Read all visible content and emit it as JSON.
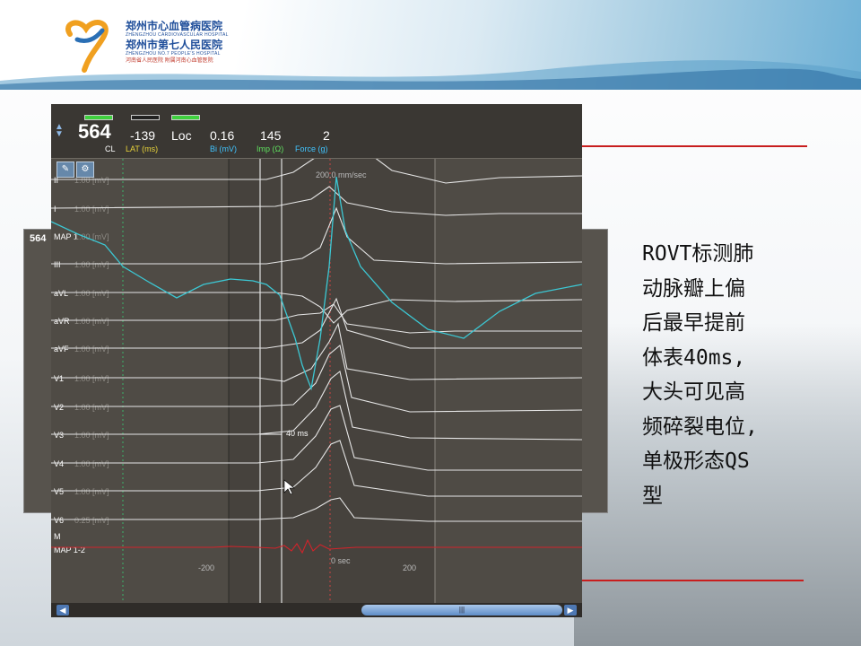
{
  "header": {
    "hospital_line1": "郑州市心血管病医院",
    "hospital_line1_en": "ZHENGZHOU CARDIOVASCULAR HOSPITAL",
    "hospital_line2": "郑州市第七人民医院",
    "hospital_line2_en": "ZHENGZHOU NO.7 PEOPLE'S HOSPITAL",
    "hospital_line3": "河南省人民医院 附属河南心血管医院"
  },
  "slide": {
    "title_partial": "……",
    "description_lines": [
      "ROVT标测肺",
      "动脉瓣上偏",
      "后最早提前",
      "体表40ms,",
      "大头可见高",
      "频碎裂电位,",
      "单极形态QS",
      "型"
    ]
  },
  "toolbar": {
    "cl_value": "564",
    "cl_label": "CL",
    "lat_value": "-139",
    "lat_label": "LAT (ms)",
    "loc_value": "Loc",
    "bi_value": "0.16",
    "bi_label": "Bi (mV)",
    "imp_value": "145",
    "imp_label": "Imp (Ω)",
    "force_value": "2",
    "force_label": "Force (g)"
  },
  "plot": {
    "sweep_label": "200.0 mm/sec",
    "interval_label": "40 ms",
    "axis_ticks": [
      "-200",
      "0 sec",
      "200"
    ],
    "channels": [
      {
        "name": "II",
        "gain": "1.00 [mV]"
      },
      {
        "name": "I",
        "gain": "1.00 [mV]"
      },
      {
        "name": "MAP 1",
        "gain": "1.00 [mV]"
      },
      {
        "name": "III",
        "gain": "1.00 [mV]"
      },
      {
        "name": "aVL",
        "gain": "1.00 [mV]"
      },
      {
        "name": "aVR",
        "gain": "1.00 [mV]"
      },
      {
        "name": "aVF",
        "gain": "1.00 [mV]"
      },
      {
        "name": "V1",
        "gain": "1.00 [mV]"
      },
      {
        "name": "V2",
        "gain": "1.00 [mV]"
      },
      {
        "name": "V3",
        "gain": "1.00 [mV]"
      },
      {
        "name": "V4",
        "gain": "1.00 [mV]"
      },
      {
        "name": "V5",
        "gain": "1.00 [mV]"
      },
      {
        "name": "V6",
        "gain": "0.25 [mV]"
      },
      {
        "name": "M",
        "gain": ""
      },
      {
        "name": "MAP 1-2",
        "gain": ""
      }
    ]
  },
  "background_window": {
    "cl_value": "564"
  },
  "colors": {
    "accent_red": "#c81e1e",
    "trace_white": "#e6e6e6",
    "trace_cyan": "#3cc7d3",
    "trace_red": "#d2232a",
    "label_yellow": "#e8d33a",
    "label_cyan": "#40c4ff",
    "label_green": "#5fe05f"
  }
}
